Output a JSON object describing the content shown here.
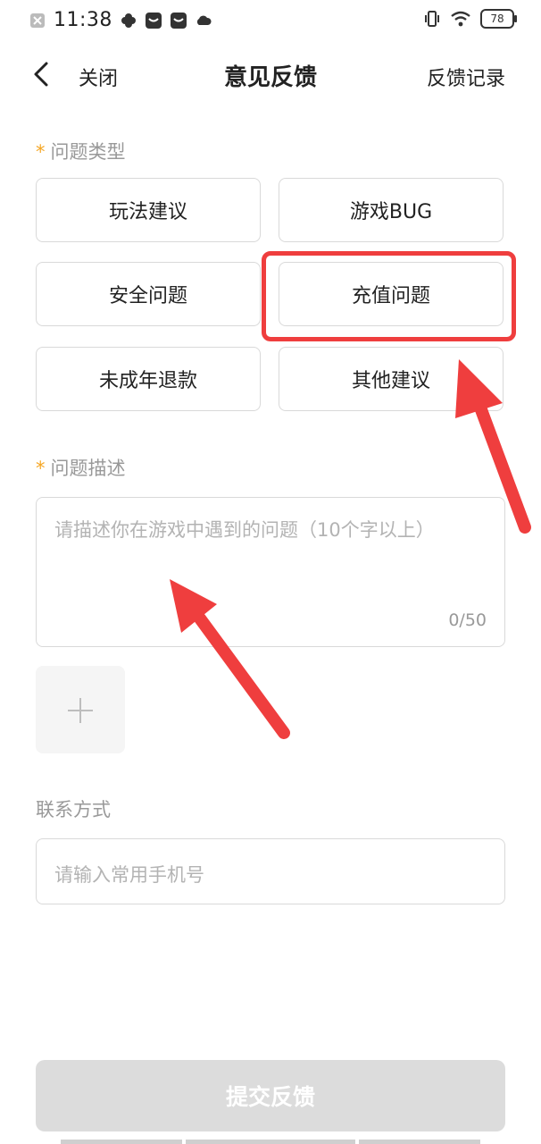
{
  "status_bar": {
    "time": "11:38",
    "battery": "78",
    "icons": [
      "close-notification-icon",
      "fan-icon",
      "app-icon",
      "app-icon",
      "cloud-icon",
      "vibrate-icon",
      "wifi-icon",
      "battery-icon"
    ]
  },
  "header": {
    "close_label": "关闭",
    "title": "意见反馈",
    "history_label": "反馈记录"
  },
  "problem_type": {
    "star": "*",
    "label": "问题类型",
    "options": [
      "玩法建议",
      "游戏BUG",
      "安全问题",
      "充值问题",
      "未成年退款",
      "其他建议"
    ]
  },
  "description": {
    "star": "*",
    "label": "问题描述",
    "placeholder": "请描述你在游戏中遇到的问题（10个字以上）",
    "count": "0/50"
  },
  "contact": {
    "label": "联系方式",
    "placeholder": "请输入常用手机号"
  },
  "submit_label": "提交反馈",
  "colors": {
    "annotation_red": "#ef3e3e",
    "required_star": "#f5a623",
    "submit_disabled": "#dcdcdc"
  }
}
